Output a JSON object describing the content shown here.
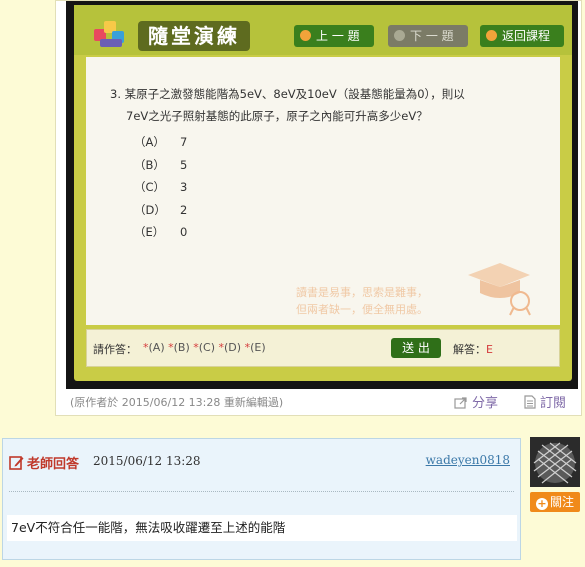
{
  "photo": {
    "screen": {
      "app_title": "隨堂演練",
      "nav": {
        "prev": "上 一 題",
        "next": "下 一 題",
        "back": "返回課程"
      },
      "question": {
        "number": "3.",
        "line1": "某原子之激發態能階為5eV、8eV及10eV（設基態能量為0），則以",
        "line2": "7eV之光子照射基態的此原子，原子之內能可升高多少eV？"
      },
      "choices": [
        {
          "label": "（A）",
          "value": "7"
        },
        {
          "label": "（B）",
          "value": "5"
        },
        {
          "label": "（C）",
          "value": "3"
        },
        {
          "label": "（D）",
          "value": "2"
        },
        {
          "label": "（E）",
          "value": "0"
        }
      ],
      "proverb": {
        "line1": "讀書是易事，思索是難事，",
        "line2": "但兩者缺一，便全無用處。"
      },
      "answer_bar": {
        "prompt": "請作答：",
        "options": [
          "(A)",
          "(B)",
          "(C)",
          "(D)",
          "(E)"
        ],
        "submit": "送 出",
        "key_label": "解答：",
        "key_value": "E"
      }
    },
    "meta_note": "(原作者於 2015/06/12 13:28 重新編輯過)",
    "share": "分享",
    "subscribe": "訂閱"
  },
  "answer": {
    "tag": "老師回答",
    "time": "2015/06/12 13:28",
    "user": "wadeyen0818",
    "text": "7eV不符合任一能階，無法吸收躍遷至上述的能階",
    "follow": "關注"
  },
  "colors": {
    "monitor_frame": "#c9cc46",
    "nav_green": "#3a7f1d",
    "teacher_red": "#c0392b",
    "link_purple": "#7f6aa8",
    "follow_orange": "#f08a1a"
  }
}
